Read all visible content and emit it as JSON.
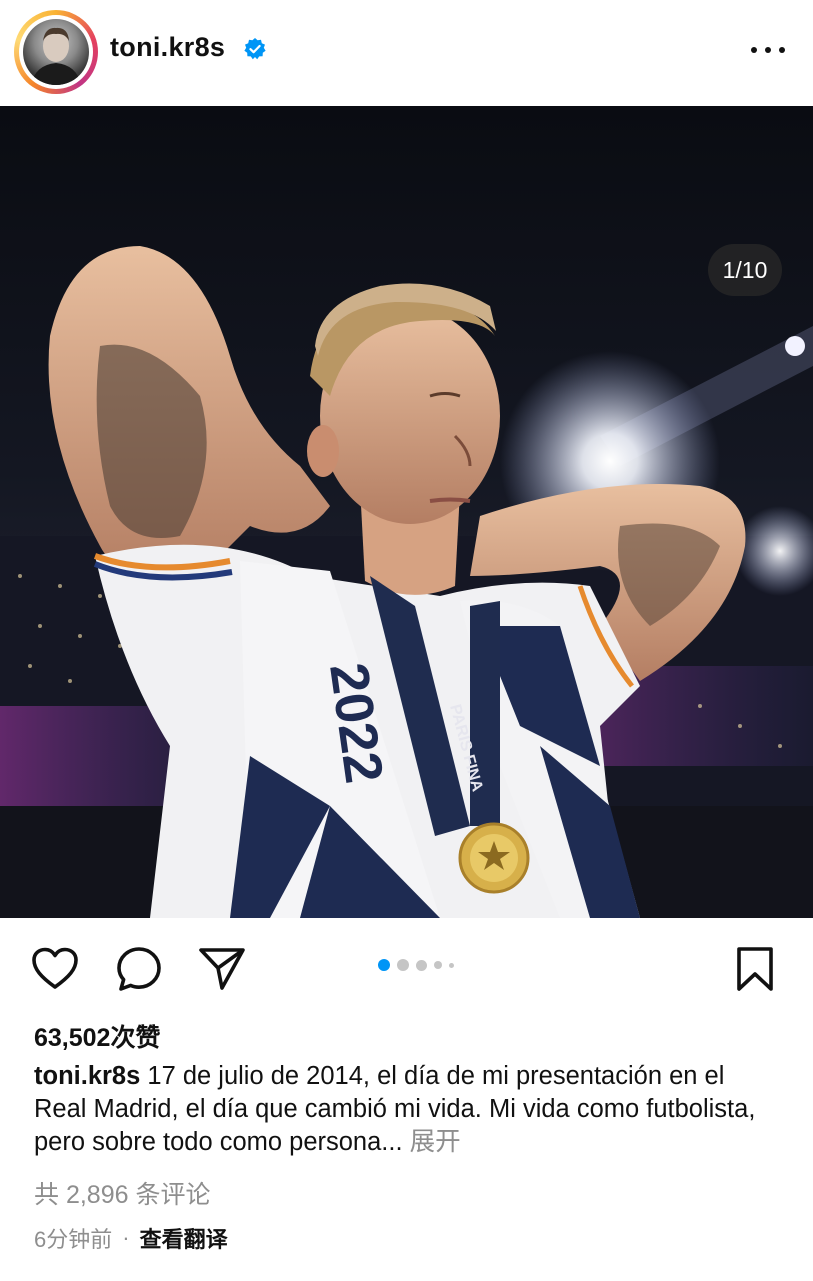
{
  "header": {
    "username": "toni.kr8s",
    "verified": true
  },
  "post": {
    "carousel_counter": "1/10",
    "carousel_total_dots": 5,
    "carousel_active_index": 0,
    "scarf_text": "2022",
    "medal_ribbon_text": "PARIS FINA",
    "ribbon_top_text": "FINAL 2022"
  },
  "actions": {
    "like_icon": "heart-icon",
    "comment_icon": "comment-icon",
    "share_icon": "send-icon",
    "save_icon": "bookmark-icon"
  },
  "likes": {
    "text": "63,502次赞"
  },
  "caption": {
    "username": "toni.kr8s",
    "text": "17 de julio de 2014, el día de mi presentación en el Real Madrid, el día que cambió mi vida. Mi vida como futbolista, pero sobre todo como persona...",
    "more_label": "展开"
  },
  "comments": {
    "text": "共 2,896 条评论"
  },
  "meta": {
    "time": "6分钟前",
    "separator": "·",
    "translate_label": "查看翻译"
  },
  "colors": {
    "accent_blue": "#0095f6",
    "muted_gray": "#8e8e8e",
    "text": "#111111"
  }
}
